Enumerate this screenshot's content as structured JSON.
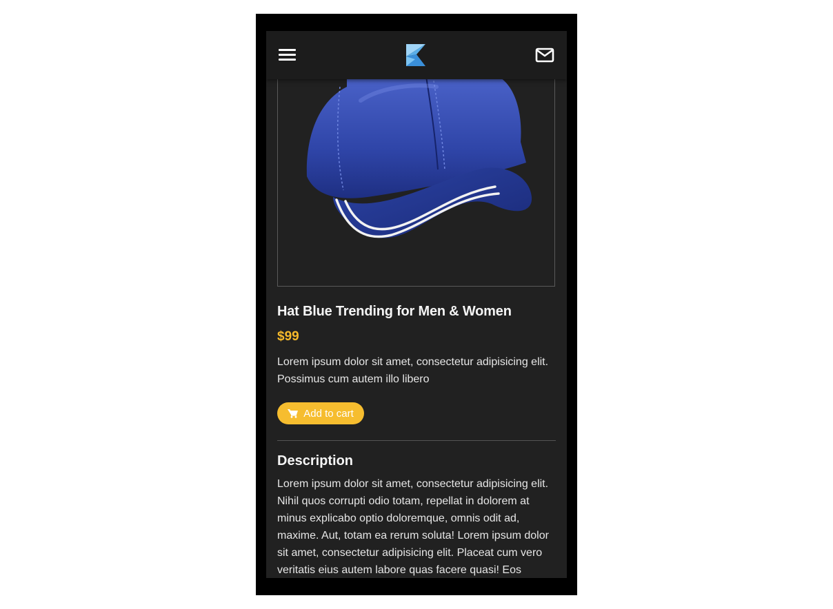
{
  "header": {
    "menu_icon": "hamburger-menu-icon",
    "logo_icon": "brand-logo-icon",
    "mail_icon": "envelope-icon"
  },
  "product": {
    "image": "blue-baseball-cap",
    "title": "Hat Blue Trending for Men & Women",
    "price": "$99",
    "short_description": "Lorem ipsum dolor sit amet, consectetur adipisicing elit. Possimus cum autem illo libero",
    "add_to_cart_label": "Add to cart",
    "cart_icon": "shopping-cart-icon"
  },
  "description": {
    "heading": "Description",
    "text": "Lorem ipsum dolor sit amet, consectetur adipisicing elit. Nihil quos corrupti odio totam, repellat in dolorem at minus explicabo optio doloremque, omnis odit ad, maxime. Aut, totam ea rerum soluta! Lorem ipsum dolor sit amet, consectetur adipisicing elit. Placeat cum vero veritatis eius autem labore quas facere quasi! Eos"
  },
  "colors": {
    "accent": "#f6bd2f",
    "price": "#f6b92b",
    "background": "#212121",
    "topbar": "#1c1c1c",
    "logo_light": "#9fd4f7",
    "logo_dark": "#3a8fd9"
  }
}
